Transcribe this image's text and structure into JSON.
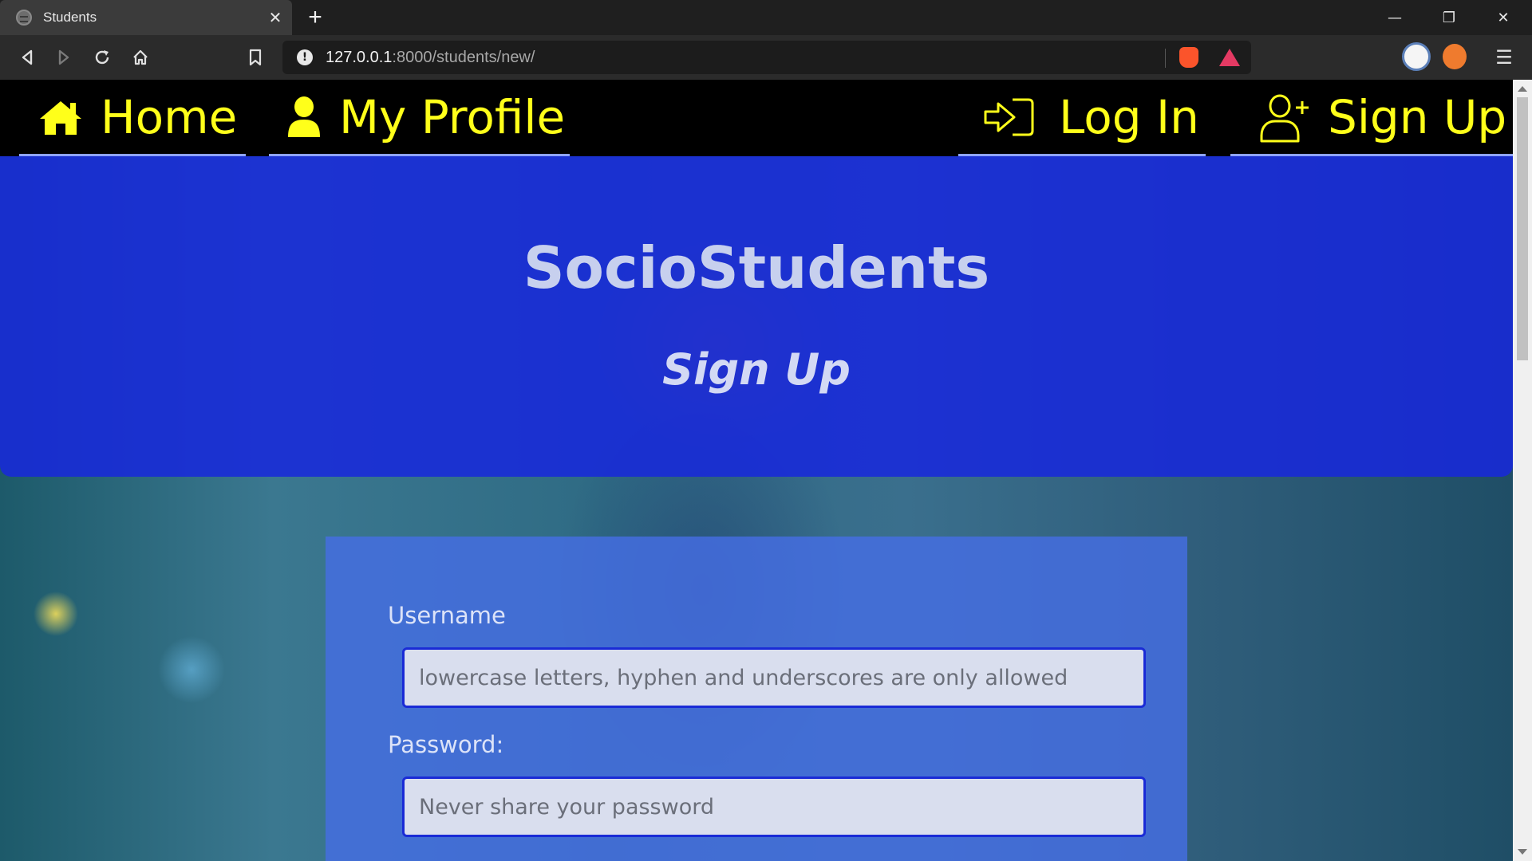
{
  "browser": {
    "tab_title": "Students",
    "tab_close": "✕",
    "new_tab": "+",
    "url_host": "127.0.0.1",
    "url_path": ":8000/students/new/",
    "window_controls": {
      "minimize": "—",
      "restore": "❐",
      "close": "✕"
    },
    "menu": "☰"
  },
  "navbar": {
    "home": {
      "label": "Home",
      "icon": "home-icon"
    },
    "profile": {
      "label": "My Profile",
      "icon": "user-icon"
    },
    "login": {
      "label": "Log In",
      "icon": "sign-in-icon"
    },
    "signup": {
      "label": "Sign Up",
      "icon": "user-plus-icon"
    },
    "text_color": "#ffff1a"
  },
  "hero": {
    "title": "SocioStudents",
    "subtitle": "Sign Up",
    "background": "#1728dc"
  },
  "form": {
    "username_label": "Username",
    "username_placeholder": "lowercase letters, hyphen and underscores are only allowed",
    "password_label": "Password:",
    "password_placeholder": "Never share your password"
  }
}
